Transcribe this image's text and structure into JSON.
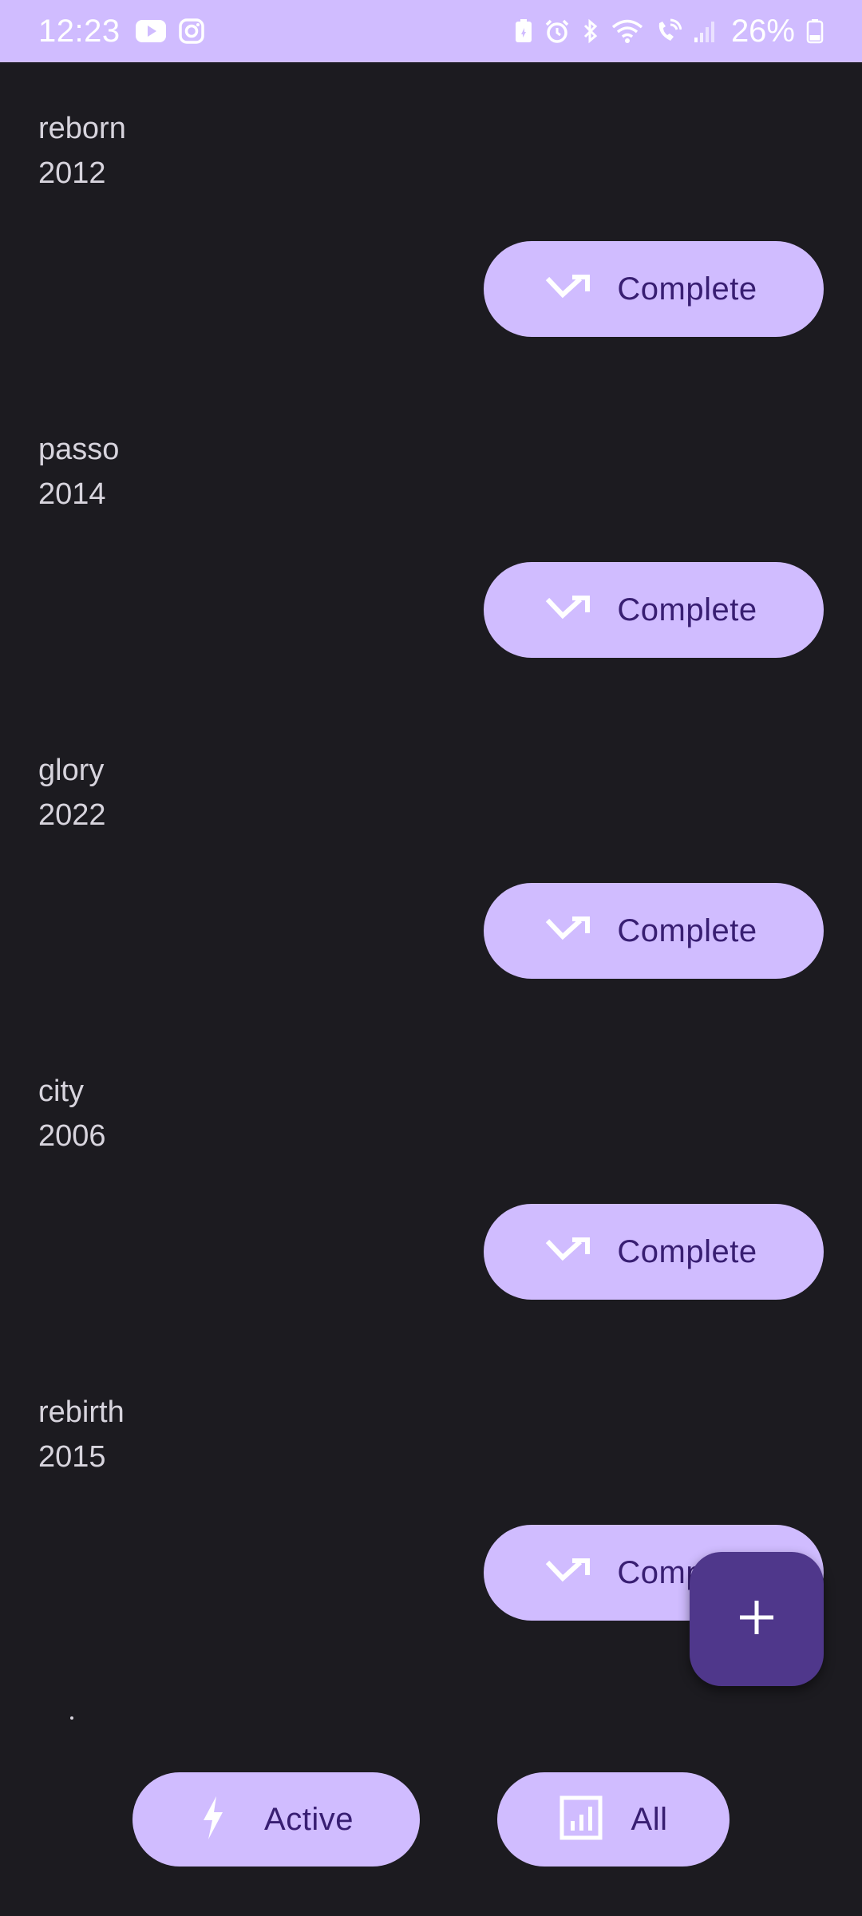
{
  "status_bar": {
    "time": "12:23",
    "battery": "26%",
    "left_icons": [
      "youtube-icon",
      "instagram-icon"
    ],
    "right_icons": [
      "battery-saver-icon",
      "alarm-icon",
      "bluetooth-icon",
      "wifi-icon",
      "wifi-calling-icon",
      "signal-icon",
      "battery-icon"
    ],
    "background": "#d0bcff"
  },
  "items": [
    {
      "title": "reborn",
      "year": "2012",
      "action_label": "Complete"
    },
    {
      "title": "passo",
      "year": "2014",
      "action_label": "Complete"
    },
    {
      "title": "glory",
      "year": "2022",
      "action_label": "Complete"
    },
    {
      "title": "city",
      "year": "2006",
      "action_label": "Complete"
    },
    {
      "title": "rebirth",
      "year": "2015",
      "action_label": "Complete"
    }
  ],
  "fab": {
    "icon": "plus-icon"
  },
  "bottom_bar": {
    "active_label": "Active",
    "active_icon": "lightning-icon",
    "all_label": "All",
    "all_icon": "chart-icon"
  },
  "colors": {
    "background": "#1c1b20",
    "button_bg": "#d0bcff",
    "button_text": "#381e72",
    "fab_bg": "#4f378b",
    "text": "#d7d4dd"
  }
}
